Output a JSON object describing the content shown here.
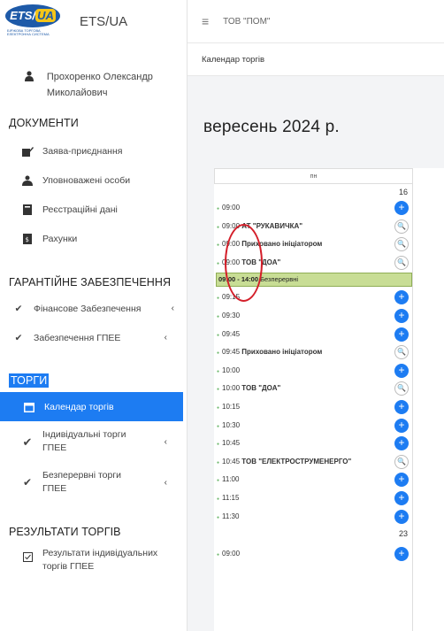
{
  "logo": {
    "text": "ETS/UA",
    "small": "БІРЖОВА ТОРГОВА ЕЛЕКТРОННА СИСТЕМА"
  },
  "app_title": "ETS/UA",
  "user": {
    "name": "Прохоренко Олександр Миколайович"
  },
  "sidebar": {
    "sec_docs": "ДОКУМЕНТИ",
    "docs": [
      "Заява-приєднання",
      "Уповноважені особи",
      "Реєстраційні дані",
      "Рахунки"
    ],
    "sec_guar": "ГАРАНТІЙНЕ ЗАБЕЗПЕЧЕННЯ",
    "guar": [
      "Фінансове Забезпечення",
      "Забезпечення ГПЕЕ"
    ],
    "sec_trades": "ТОРГИ",
    "trades": [
      "Календар торгів",
      "Індивідуальні торги ГПЕЕ",
      "Безперервні торги ГПЕЕ"
    ],
    "sec_results": "РЕЗУЛЬТАТИ ТОРГІВ",
    "results": [
      "Результати індивідуальних торгів ГПЕЕ"
    ]
  },
  "topbar": {
    "company": "ТОВ \"ПОМ\""
  },
  "breadcrumb": "Календар торгів",
  "month_title": "вересень 2024 р.",
  "calendar": {
    "weekday": "пн",
    "day1": "16",
    "day2": "23",
    "green_bar": {
      "time": "09:00 - 14:00",
      "label": "Безперервні"
    },
    "events": [
      {
        "time": "09:00",
        "org": "",
        "btn": "plus"
      },
      {
        "time": "09:00",
        "org": "АТ \"РУКАВИЧКА\"",
        "btn": "search"
      },
      {
        "time": "09:00",
        "org": "Приховано ініціатором",
        "btn": "search"
      },
      {
        "time": "09:00",
        "org": "ТОВ \"ДОА\"",
        "btn": "search"
      },
      {
        "time": "09:15",
        "org": "",
        "btn": "plus"
      },
      {
        "time": "09:30",
        "org": "",
        "btn": "plus"
      },
      {
        "time": "09:45",
        "org": "",
        "btn": "plus"
      },
      {
        "time": "09:45",
        "org": "Приховано ініціатором",
        "btn": "search"
      },
      {
        "time": "10:00",
        "org": "",
        "btn": "plus"
      },
      {
        "time": "10:00",
        "org": "ТОВ \"ДОА\"",
        "btn": "search"
      },
      {
        "time": "10:15",
        "org": "",
        "btn": "plus"
      },
      {
        "time": "10:30",
        "org": "",
        "btn": "plus"
      },
      {
        "time": "10:45",
        "org": "",
        "btn": "plus"
      },
      {
        "time": "10:45",
        "org": "ТОВ \"ЕЛЕКТРОСТРУМЕНЕРГО\"",
        "btn": "search"
      },
      {
        "time": "11:00",
        "org": "",
        "btn": "plus"
      },
      {
        "time": "11:15",
        "org": "",
        "btn": "plus"
      },
      {
        "time": "11:30",
        "org": "",
        "btn": "plus"
      }
    ],
    "event_next": {
      "time": "09:00",
      "btn": "plus"
    }
  },
  "colors": {
    "accent": "#1d7cf2",
    "highlight": "#c8dd95",
    "annotation": "#d41f2a"
  }
}
